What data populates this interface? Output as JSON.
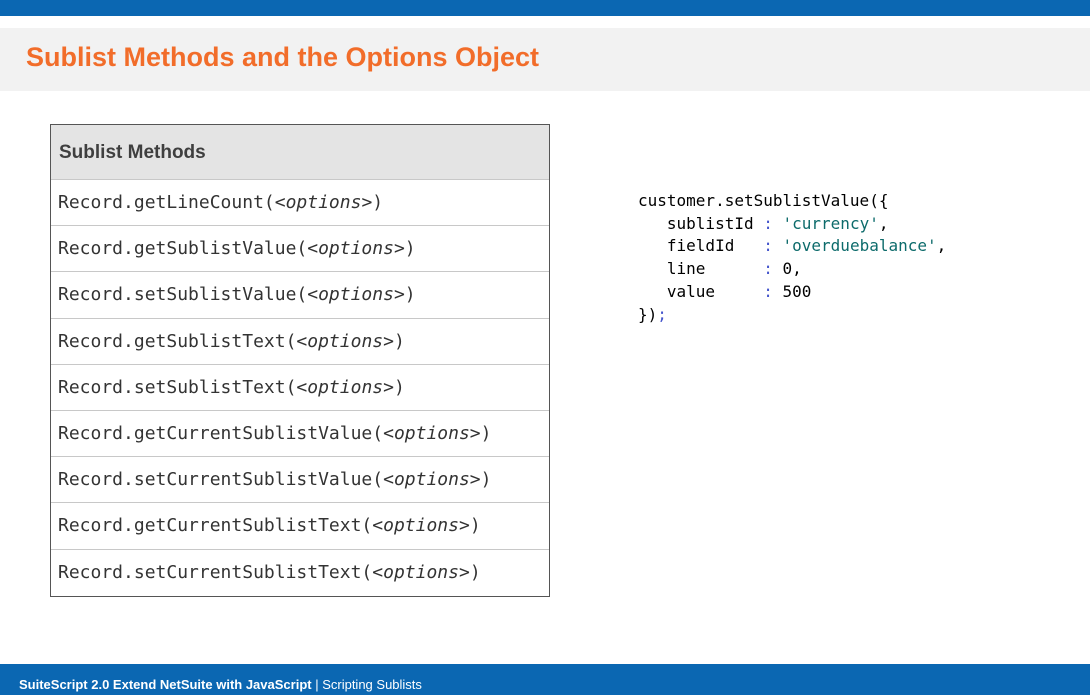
{
  "slide": {
    "title": "Sublist Methods and the Options Object"
  },
  "methods_table": {
    "header": "Sublist Methods",
    "rows": [
      {
        "method": "Record.getLineCount(",
        "arg": "<options>",
        "close": ")"
      },
      {
        "method": "Record.getSublistValue(",
        "arg": "<options>",
        "close": ")"
      },
      {
        "method": "Record.setSublistValue(",
        "arg": "<options>",
        "close": ")"
      },
      {
        "method": "Record.getSublistText(",
        "arg": "<options>",
        "close": ")"
      },
      {
        "method": "Record.setSublistText(",
        "arg": "<options>",
        "close": ")"
      },
      {
        "method": "Record.getCurrentSublistValue(",
        "arg": "<options>",
        "close": ")"
      },
      {
        "method": "Record.setCurrentSublistValue(",
        "arg": "<options>",
        "close": ")"
      },
      {
        "method": "Record.getCurrentSublistText(",
        "arg": "<options>",
        "close": ")"
      },
      {
        "method": "Record.setCurrentSublistText(",
        "arg": "<options>",
        "close": ")"
      }
    ]
  },
  "code_example": {
    "open": "customer.setSublistValue({",
    "lines": [
      {
        "key": "   sublistId ",
        "colon": ":",
        "value": " 'currency'",
        "trail": ","
      },
      {
        "key": "   fieldId   ",
        "colon": ":",
        "value": " 'overduebalance'",
        "trail": ","
      },
      {
        "key": "   line      ",
        "colon": ":",
        "value": " 0",
        "trail": ","
      },
      {
        "key": "   value     ",
        "colon": ":",
        "value": " 500",
        "trail": ""
      }
    ],
    "close": "})",
    "semicolon": ";"
  },
  "footer": {
    "course": "SuiteScript 2.0 Extend NetSuite with JavaScript",
    "separator": " | ",
    "section": "Scripting Sublists"
  },
  "colors": {
    "brand_blue": "#0b67b2",
    "title_orange": "#f26d2a",
    "string_teal": "#0d6b6b",
    "colon_blue": "#4455cc"
  }
}
